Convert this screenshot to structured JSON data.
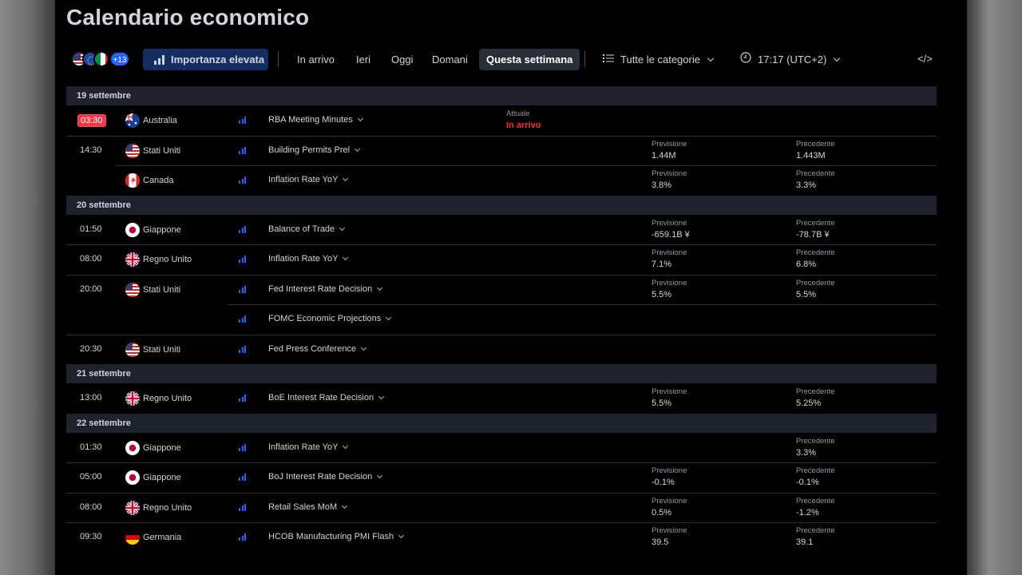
{
  "title": "Calendario economico",
  "toolbar": {
    "more_countries": "+13",
    "importance": "Importanza elevata",
    "tabs": [
      "In arrivo",
      "Ieri",
      "Oggi",
      "Domani",
      "Questa settimana"
    ],
    "active_tab": "Questa settimana",
    "categories": "Tutte le categorie",
    "timezone": "17:17 (UTC+2)",
    "embed_icon": "</>"
  },
  "labels": {
    "actual": "Attuale",
    "forecast": "Previsione",
    "previous": "Precedente"
  },
  "colors": {
    "accent": "#2962ff",
    "alert": "#f23645",
    "row_header_bg": "#1e222d"
  },
  "days": [
    {
      "date": "19 settembre",
      "events": [
        {
          "time": "03:30",
          "time_badge": true,
          "country": "Australia",
          "flag": "au",
          "name": "RBA Meeting Minutes",
          "actual_label": "Attuale",
          "actual": "In arrivo"
        },
        {
          "time": "14:30",
          "country": "Stati Uniti",
          "flag": "us",
          "name": "Building Permits Prel",
          "forecast": "1.44M",
          "previous": "1.443M"
        },
        {
          "time": "",
          "country": "Canada",
          "flag": "ca",
          "name": "Inflation Rate YoY",
          "forecast": "3.8%",
          "previous": "3.3%"
        }
      ]
    },
    {
      "date": "20 settembre",
      "events": [
        {
          "time": "01:50",
          "country": "Giappone",
          "flag": "jp",
          "name": "Balance of Trade",
          "forecast": "-659.1B ¥",
          "previous": "-78.7B ¥"
        },
        {
          "time": "08:00",
          "country": "Regno Unito",
          "flag": "gb",
          "name": "Inflation Rate YoY",
          "forecast": "7.1%",
          "previous": "6.8%"
        },
        {
          "time": "20:00",
          "country": "Stati Uniti",
          "flag": "us",
          "name": "Fed Interest Rate Decision",
          "forecast": "5.5%",
          "previous": "5.5%"
        },
        {
          "time": "",
          "country": "",
          "flag": "",
          "name": "FOMC Economic Projections"
        },
        {
          "time": "20:30",
          "country": "Stati Uniti",
          "flag": "us",
          "name": "Fed Press Conference"
        }
      ]
    },
    {
      "date": "21 settembre",
      "events": [
        {
          "time": "13:00",
          "country": "Regno Unito",
          "flag": "gb",
          "name": "BoE Interest Rate Decision",
          "forecast": "5.5%",
          "previous": "5.25%"
        }
      ]
    },
    {
      "date": "22 settembre",
      "events": [
        {
          "time": "01:30",
          "country": "Giappone",
          "flag": "jp",
          "name": "Inflation Rate YoY",
          "previous": "3.3%"
        },
        {
          "time": "05:00",
          "country": "Giappone",
          "flag": "jp",
          "name": "BoJ Interest Rate Decision",
          "forecast": "-0.1%",
          "previous": "-0.1%"
        },
        {
          "time": "08:00",
          "country": "Regno Unito",
          "flag": "gb",
          "name": "Retail Sales MoM",
          "forecast": "0.5%",
          "previous": "-1.2%"
        },
        {
          "time": "09:30",
          "country": "Germania",
          "flag": "de",
          "name": "HCOB Manufacturing PMI Flash",
          "forecast": "39.5",
          "previous": "39.1"
        }
      ]
    }
  ]
}
